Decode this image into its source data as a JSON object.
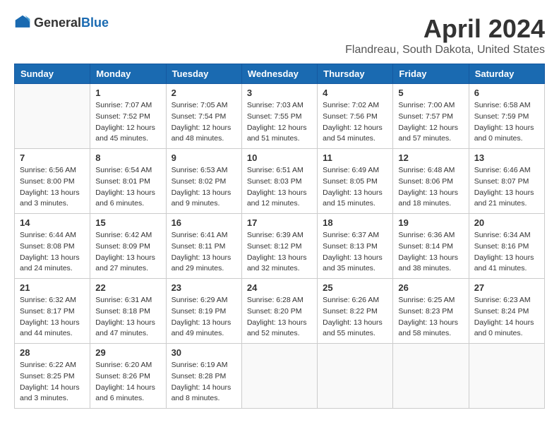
{
  "header": {
    "logo_general": "General",
    "logo_blue": "Blue",
    "month_title": "April 2024",
    "location": "Flandreau, South Dakota, United States"
  },
  "weekdays": [
    "Sunday",
    "Monday",
    "Tuesday",
    "Wednesday",
    "Thursday",
    "Friday",
    "Saturday"
  ],
  "weeks": [
    [
      {
        "day": "",
        "sunrise": "",
        "sunset": "",
        "daylight": ""
      },
      {
        "day": "1",
        "sunrise": "Sunrise: 7:07 AM",
        "sunset": "Sunset: 7:52 PM",
        "daylight": "Daylight: 12 hours and 45 minutes."
      },
      {
        "day": "2",
        "sunrise": "Sunrise: 7:05 AM",
        "sunset": "Sunset: 7:54 PM",
        "daylight": "Daylight: 12 hours and 48 minutes."
      },
      {
        "day": "3",
        "sunrise": "Sunrise: 7:03 AM",
        "sunset": "Sunset: 7:55 PM",
        "daylight": "Daylight: 12 hours and 51 minutes."
      },
      {
        "day": "4",
        "sunrise": "Sunrise: 7:02 AM",
        "sunset": "Sunset: 7:56 PM",
        "daylight": "Daylight: 12 hours and 54 minutes."
      },
      {
        "day": "5",
        "sunrise": "Sunrise: 7:00 AM",
        "sunset": "Sunset: 7:57 PM",
        "daylight": "Daylight: 12 hours and 57 minutes."
      },
      {
        "day": "6",
        "sunrise": "Sunrise: 6:58 AM",
        "sunset": "Sunset: 7:59 PM",
        "daylight": "Daylight: 13 hours and 0 minutes."
      }
    ],
    [
      {
        "day": "7",
        "sunrise": "Sunrise: 6:56 AM",
        "sunset": "Sunset: 8:00 PM",
        "daylight": "Daylight: 13 hours and 3 minutes."
      },
      {
        "day": "8",
        "sunrise": "Sunrise: 6:54 AM",
        "sunset": "Sunset: 8:01 PM",
        "daylight": "Daylight: 13 hours and 6 minutes."
      },
      {
        "day": "9",
        "sunrise": "Sunrise: 6:53 AM",
        "sunset": "Sunset: 8:02 PM",
        "daylight": "Daylight: 13 hours and 9 minutes."
      },
      {
        "day": "10",
        "sunrise": "Sunrise: 6:51 AM",
        "sunset": "Sunset: 8:03 PM",
        "daylight": "Daylight: 13 hours and 12 minutes."
      },
      {
        "day": "11",
        "sunrise": "Sunrise: 6:49 AM",
        "sunset": "Sunset: 8:05 PM",
        "daylight": "Daylight: 13 hours and 15 minutes."
      },
      {
        "day": "12",
        "sunrise": "Sunrise: 6:48 AM",
        "sunset": "Sunset: 8:06 PM",
        "daylight": "Daylight: 13 hours and 18 minutes."
      },
      {
        "day": "13",
        "sunrise": "Sunrise: 6:46 AM",
        "sunset": "Sunset: 8:07 PM",
        "daylight": "Daylight: 13 hours and 21 minutes."
      }
    ],
    [
      {
        "day": "14",
        "sunrise": "Sunrise: 6:44 AM",
        "sunset": "Sunset: 8:08 PM",
        "daylight": "Daylight: 13 hours and 24 minutes."
      },
      {
        "day": "15",
        "sunrise": "Sunrise: 6:42 AM",
        "sunset": "Sunset: 8:09 PM",
        "daylight": "Daylight: 13 hours and 27 minutes."
      },
      {
        "day": "16",
        "sunrise": "Sunrise: 6:41 AM",
        "sunset": "Sunset: 8:11 PM",
        "daylight": "Daylight: 13 hours and 29 minutes."
      },
      {
        "day": "17",
        "sunrise": "Sunrise: 6:39 AM",
        "sunset": "Sunset: 8:12 PM",
        "daylight": "Daylight: 13 hours and 32 minutes."
      },
      {
        "day": "18",
        "sunrise": "Sunrise: 6:37 AM",
        "sunset": "Sunset: 8:13 PM",
        "daylight": "Daylight: 13 hours and 35 minutes."
      },
      {
        "day": "19",
        "sunrise": "Sunrise: 6:36 AM",
        "sunset": "Sunset: 8:14 PM",
        "daylight": "Daylight: 13 hours and 38 minutes."
      },
      {
        "day": "20",
        "sunrise": "Sunrise: 6:34 AM",
        "sunset": "Sunset: 8:16 PM",
        "daylight": "Daylight: 13 hours and 41 minutes."
      }
    ],
    [
      {
        "day": "21",
        "sunrise": "Sunrise: 6:32 AM",
        "sunset": "Sunset: 8:17 PM",
        "daylight": "Daylight: 13 hours and 44 minutes."
      },
      {
        "day": "22",
        "sunrise": "Sunrise: 6:31 AM",
        "sunset": "Sunset: 8:18 PM",
        "daylight": "Daylight: 13 hours and 47 minutes."
      },
      {
        "day": "23",
        "sunrise": "Sunrise: 6:29 AM",
        "sunset": "Sunset: 8:19 PM",
        "daylight": "Daylight: 13 hours and 49 minutes."
      },
      {
        "day": "24",
        "sunrise": "Sunrise: 6:28 AM",
        "sunset": "Sunset: 8:20 PM",
        "daylight": "Daylight: 13 hours and 52 minutes."
      },
      {
        "day": "25",
        "sunrise": "Sunrise: 6:26 AM",
        "sunset": "Sunset: 8:22 PM",
        "daylight": "Daylight: 13 hours and 55 minutes."
      },
      {
        "day": "26",
        "sunrise": "Sunrise: 6:25 AM",
        "sunset": "Sunset: 8:23 PM",
        "daylight": "Daylight: 13 hours and 58 minutes."
      },
      {
        "day": "27",
        "sunrise": "Sunrise: 6:23 AM",
        "sunset": "Sunset: 8:24 PM",
        "daylight": "Daylight: 14 hours and 0 minutes."
      }
    ],
    [
      {
        "day": "28",
        "sunrise": "Sunrise: 6:22 AM",
        "sunset": "Sunset: 8:25 PM",
        "daylight": "Daylight: 14 hours and 3 minutes."
      },
      {
        "day": "29",
        "sunrise": "Sunrise: 6:20 AM",
        "sunset": "Sunset: 8:26 PM",
        "daylight": "Daylight: 14 hours and 6 minutes."
      },
      {
        "day": "30",
        "sunrise": "Sunrise: 6:19 AM",
        "sunset": "Sunset: 8:28 PM",
        "daylight": "Daylight: 14 hours and 8 minutes."
      },
      {
        "day": "",
        "sunrise": "",
        "sunset": "",
        "daylight": ""
      },
      {
        "day": "",
        "sunrise": "",
        "sunset": "",
        "daylight": ""
      },
      {
        "day": "",
        "sunrise": "",
        "sunset": "",
        "daylight": ""
      },
      {
        "day": "",
        "sunrise": "",
        "sunset": "",
        "daylight": ""
      }
    ]
  ]
}
